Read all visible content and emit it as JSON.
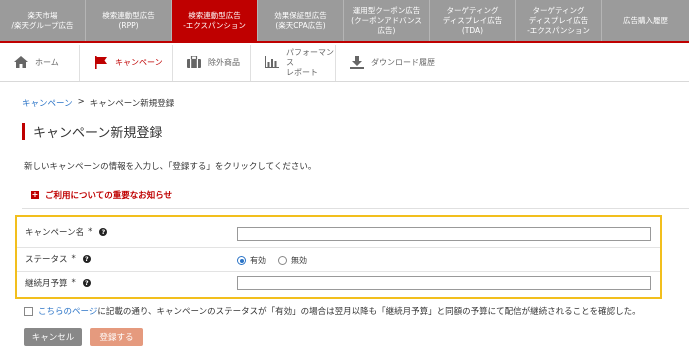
{
  "topnav": {
    "tabs": [
      {
        "label": "楽天市場\n/楽天グループ広告",
        "width": 86,
        "active": false
      },
      {
        "label": "検索連動型広告\n(RPP)",
        "width": 86,
        "active": false
      },
      {
        "label": "検索連動型広告\n-エクスパンション",
        "width": 86,
        "active": false
      },
      {
        "label": "効果保証型広告\n(楽天CPA広告)",
        "width": 86,
        "active": false
      },
      {
        "label": "運用型クーポン広告\n(クーポンアドバンス\n広告)",
        "width": 86,
        "active": false
      },
      {
        "label": "ターゲティング\nディスプレイ広告\n(TDA)",
        "width": 86,
        "active": false
      },
      {
        "label": "ターゲティング\nディスプレイ広告\n-エクスパンション",
        "width": 86,
        "active": false
      },
      {
        "label": "広告購入履歴",
        "width": 87,
        "active": false
      }
    ],
    "active_index": 2,
    "active_color": "#bf0000"
  },
  "subnav": {
    "home": "ホーム",
    "campaign": "キャンペーン",
    "excluded": "除外商品",
    "performance": "パフォーマンス\nレポート",
    "download": "ダウンロード履歴"
  },
  "breadcrumb": {
    "parent": "キャンペーン",
    "separator": ">",
    "current": "キャンペーン新規登録"
  },
  "page_title": "キャンペーン新規登録",
  "description": "新しいキャンペーンの情報を入力し、「登録する」をクリックしてください。",
  "notice": {
    "icon": "+",
    "text": "ご利用についての重要なお知らせ"
  },
  "form": {
    "campaign_name": {
      "label": "キャンペーン名",
      "required": "*",
      "value": ""
    },
    "status": {
      "label": "ステータス",
      "required": "*",
      "options": [
        "有効",
        "無効"
      ],
      "selected": "有効"
    },
    "monthly_budget": {
      "label": "継続月予算",
      "required": "*",
      "value": ""
    }
  },
  "confirm": {
    "link_text": "こちらのページ",
    "text": "に記載の通り、キャンペーンのステータスが「有効」の場合は翌月以降も「継続月予算」と同額の予算にて配信が継続されることを確認した。",
    "checked": false
  },
  "buttons": {
    "cancel": "キャンセル",
    "submit": "登録する"
  },
  "colors": {
    "accent": "#bf0000",
    "link": "#2b74c7",
    "highlight_border": "#f2bf1d"
  }
}
